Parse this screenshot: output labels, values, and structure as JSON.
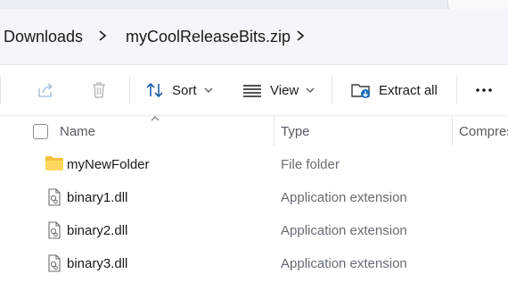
{
  "window": {
    "accent_color": "#0f6cbd",
    "folder_color": "#f3c13a"
  },
  "breadcrumb": {
    "items": [
      {
        "label": "Downloads"
      },
      {
        "label": "myCoolReleaseBits.zip"
      }
    ]
  },
  "toolbar": {
    "share_icon": "share-icon",
    "delete_icon": "delete-icon",
    "sort_label": "Sort",
    "view_label": "View",
    "extract_label": "Extract all",
    "more_icon": "more-icon"
  },
  "columns": {
    "name": "Name",
    "type": "Type",
    "compressed": "Compres"
  },
  "files": [
    {
      "name": "myNewFolder",
      "type": "File folder",
      "icon": "folder-icon"
    },
    {
      "name": "binary1.dll",
      "type": "Application extension",
      "icon": "dll-file-icon"
    },
    {
      "name": "binary2.dll",
      "type": "Application extension",
      "icon": "dll-file-icon"
    },
    {
      "name": "binary3.dll",
      "type": "Application extension",
      "icon": "dll-file-icon"
    }
  ]
}
